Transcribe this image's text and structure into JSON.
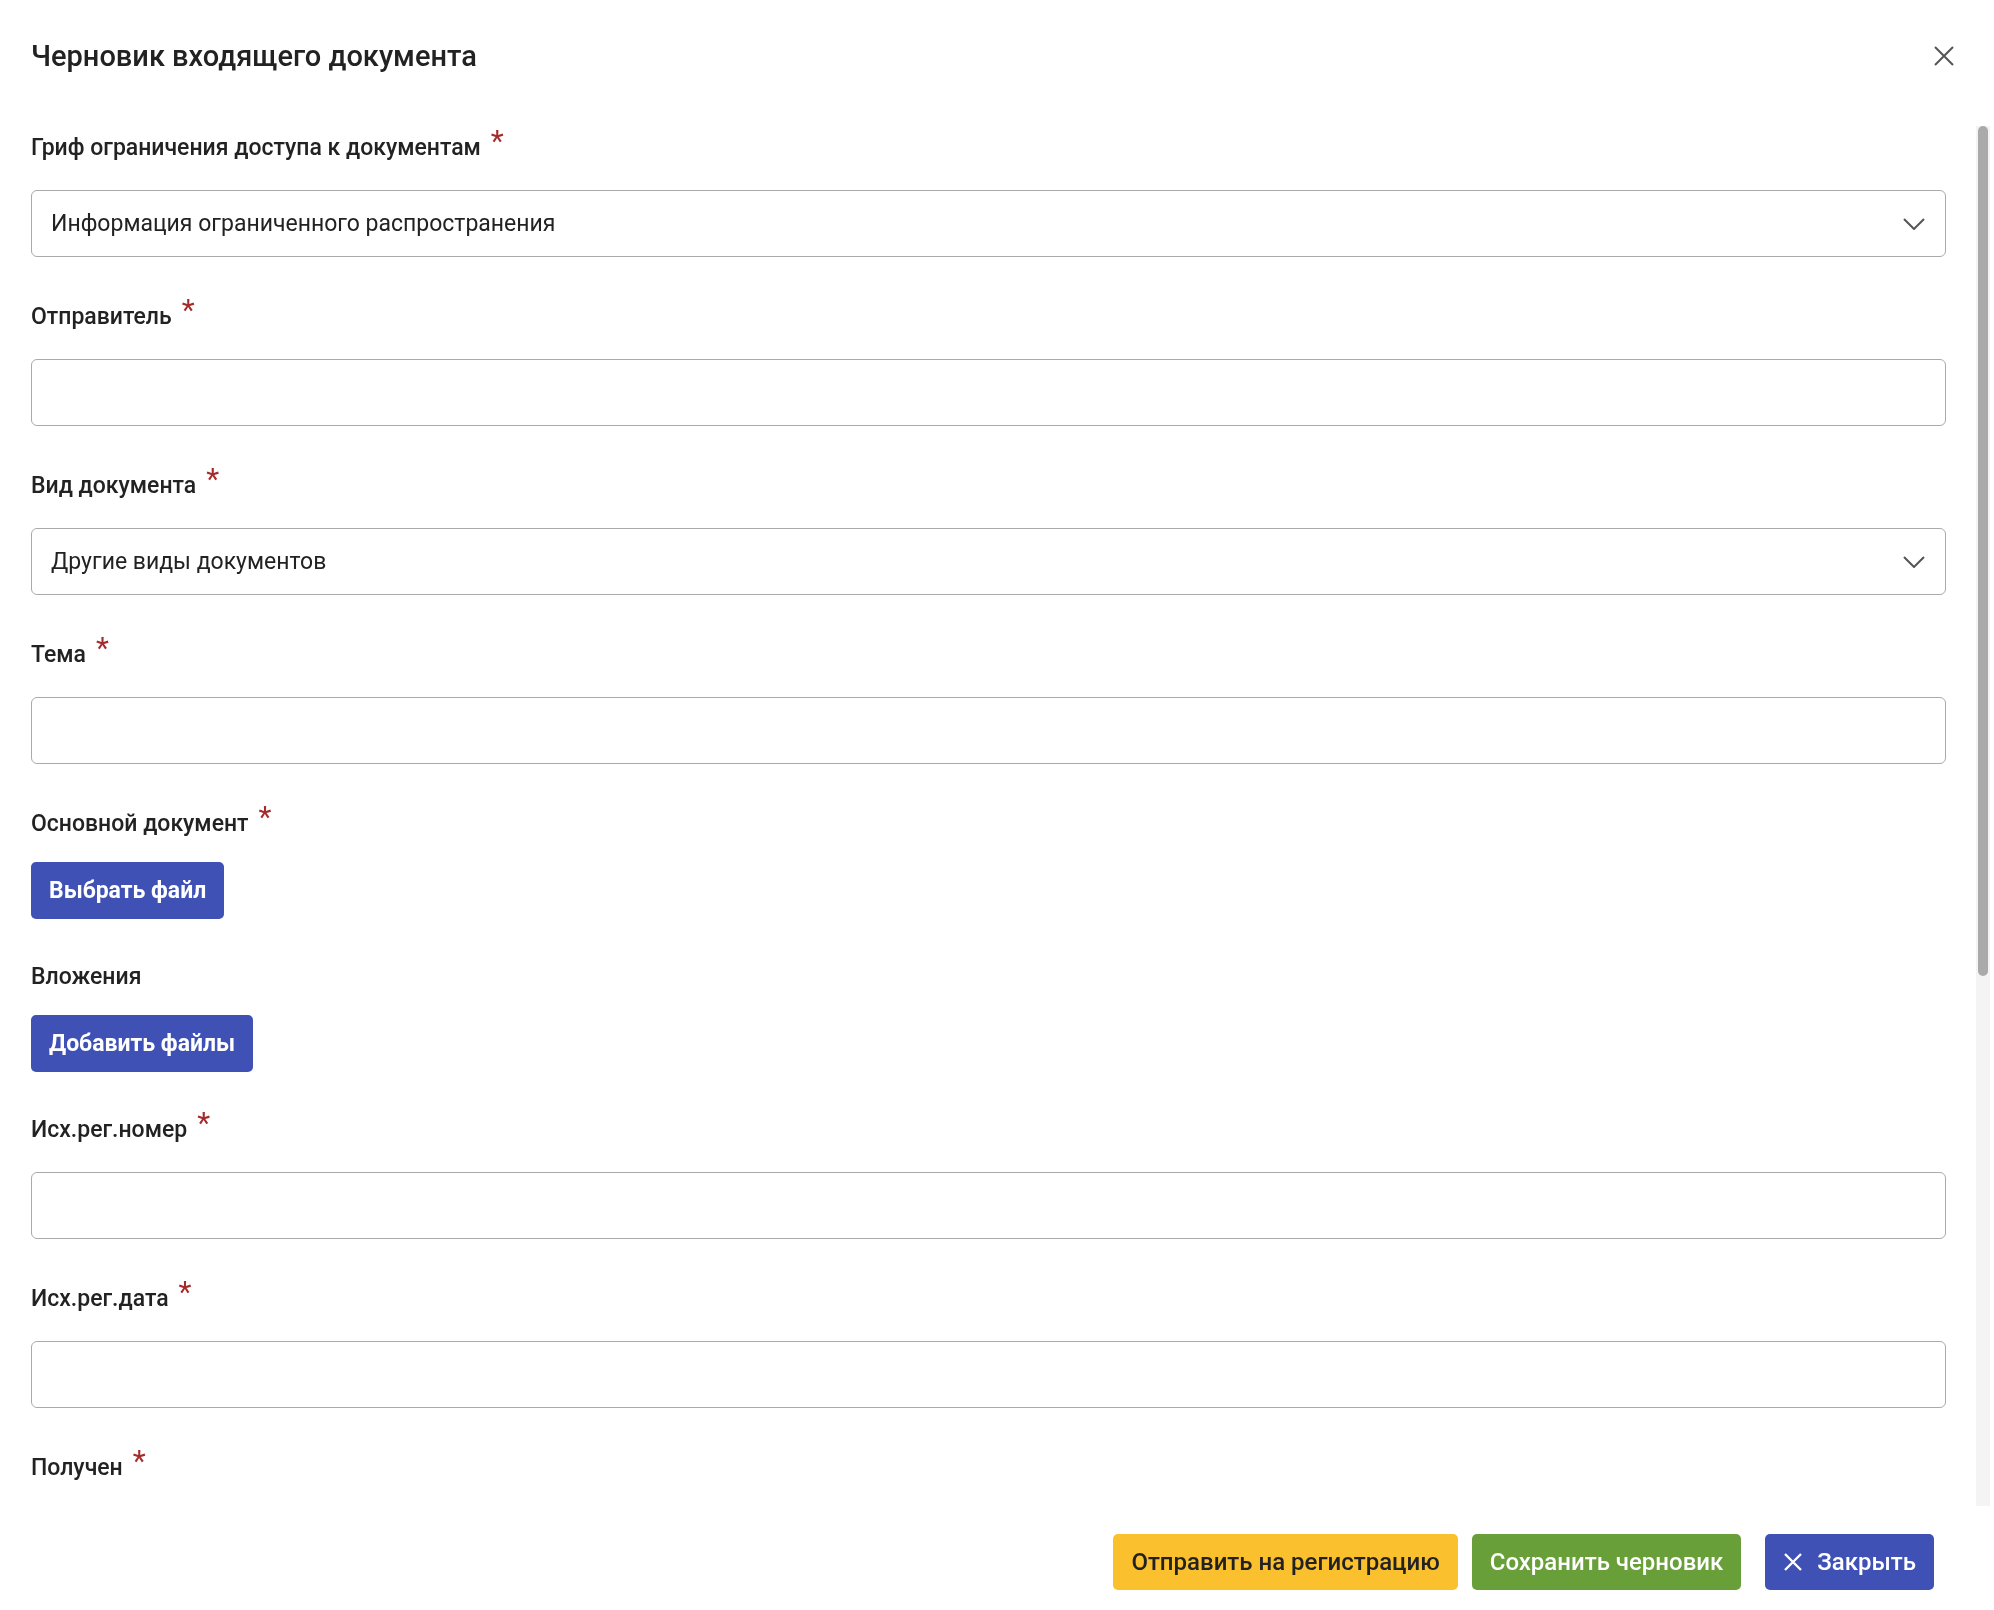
{
  "dialog": {
    "title": "Черновик входящего документа"
  },
  "fields": [
    {
      "kind": "select",
      "label": "Гриф ограничения доступа к документам",
      "required": true,
      "value": "Информация ограниченного распространения"
    },
    {
      "kind": "text",
      "label": "Отправитель",
      "required": true
    },
    {
      "kind": "select",
      "label": "Вид документа",
      "required": true,
      "value": "Другие виды документов"
    },
    {
      "kind": "text",
      "label": "Тема",
      "required": true
    },
    {
      "kind": "file",
      "label": "Основной документ",
      "required": true,
      "button": "Выбрать файл"
    },
    {
      "kind": "file",
      "label": "Вложения",
      "required": false,
      "button": "Добавить файлы"
    },
    {
      "kind": "text",
      "label": "Исх.рег.номер",
      "required": true
    },
    {
      "kind": "text",
      "label": "Исх.рег.дата",
      "required": true
    },
    {
      "kind": "none",
      "label": "Получен",
      "required": true
    }
  ],
  "required_mark": "*",
  "footer": [
    {
      "kind": "warning",
      "label": "Отправить на регистрацию"
    },
    {
      "kind": "success",
      "label": "Сохранить черновик"
    },
    {
      "kind": "close",
      "label": "Закрыть"
    }
  ]
}
